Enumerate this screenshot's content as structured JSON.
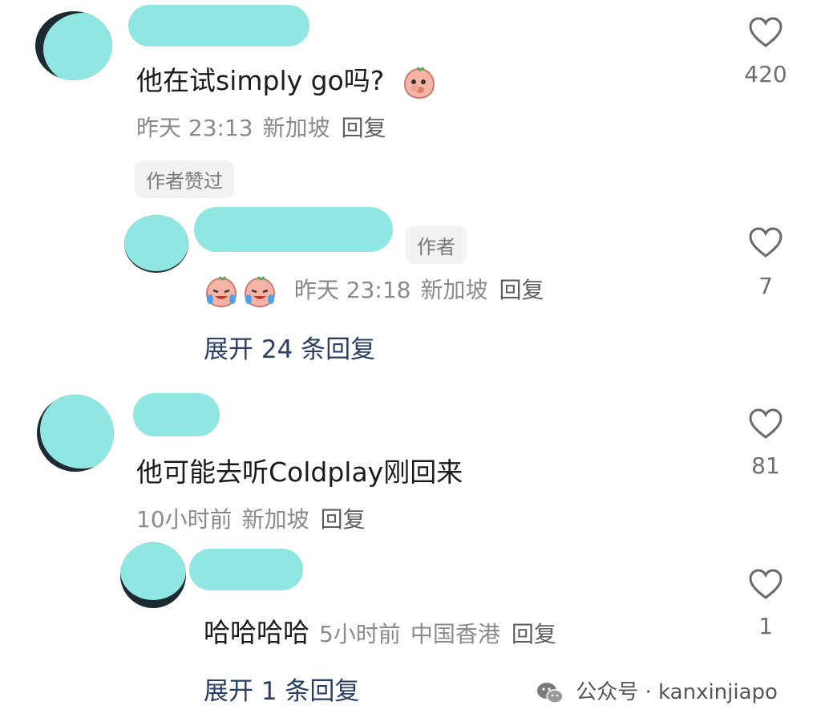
{
  "comments": [
    {
      "text": "他在试simply go吗?",
      "time": "昨天 23:13",
      "location": "新加坡",
      "reply_label": "回复",
      "likes": "420",
      "badge": "作者赞过",
      "replies": [
        {
          "badge": "作者",
          "time": "昨天 23:18",
          "location": "新加坡",
          "reply_label": "回复",
          "likes": "7"
        }
      ],
      "expand_label": "展开 24 条回复"
    },
    {
      "text": "他可能去听Coldplay刚回来",
      "time": "10小时前",
      "location": "新加坡",
      "reply_label": "回复",
      "likes": "81",
      "replies": [
        {
          "text": "哈哈哈哈",
          "time": "5小时前",
          "location": "中国香港",
          "reply_label": "回复",
          "likes": "1"
        }
      ],
      "expand_label": "展开 1 条回复"
    }
  ],
  "watermark": {
    "text": "公众号 · kanxinjiapo",
    "icon": "wechat-icon"
  },
  "colors": {
    "mask": "#8fe6e3",
    "expand_link": "#2b3f63",
    "meta_gray": "#8a8a8a"
  }
}
